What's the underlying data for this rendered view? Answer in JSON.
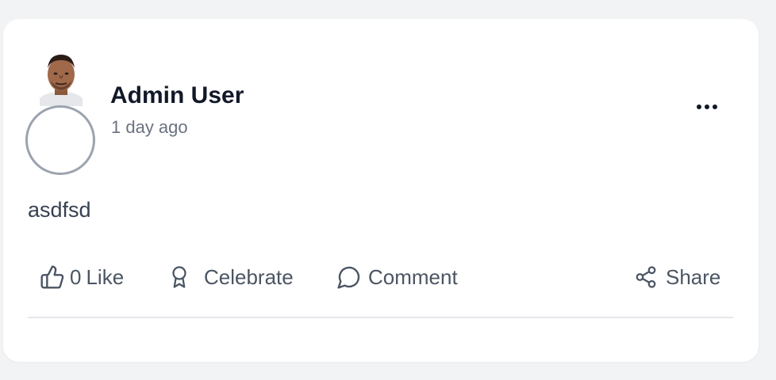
{
  "post": {
    "author_name": "Admin User",
    "timestamp": "1 day ago",
    "content": "asdfsd",
    "more_label": "...",
    "actions": {
      "like_count": "0",
      "like_label": "Like",
      "celebrate_label": "Celebrate",
      "comment_label": "Comment",
      "share_label": "Share"
    }
  },
  "icons": {
    "like": "thumbs-up-icon",
    "celebrate": "award-icon",
    "comment": "message-circle-icon",
    "share": "share-icon",
    "more": "more-horizontal-icon"
  },
  "colors": {
    "page_background": "#f2f3f5",
    "card_background": "#ffffff",
    "name_text": "#111827",
    "muted_text": "#6b7280",
    "action_text": "#4b5563",
    "avatar_ring": "#9ca3af",
    "divider": "#e5e7eb"
  }
}
